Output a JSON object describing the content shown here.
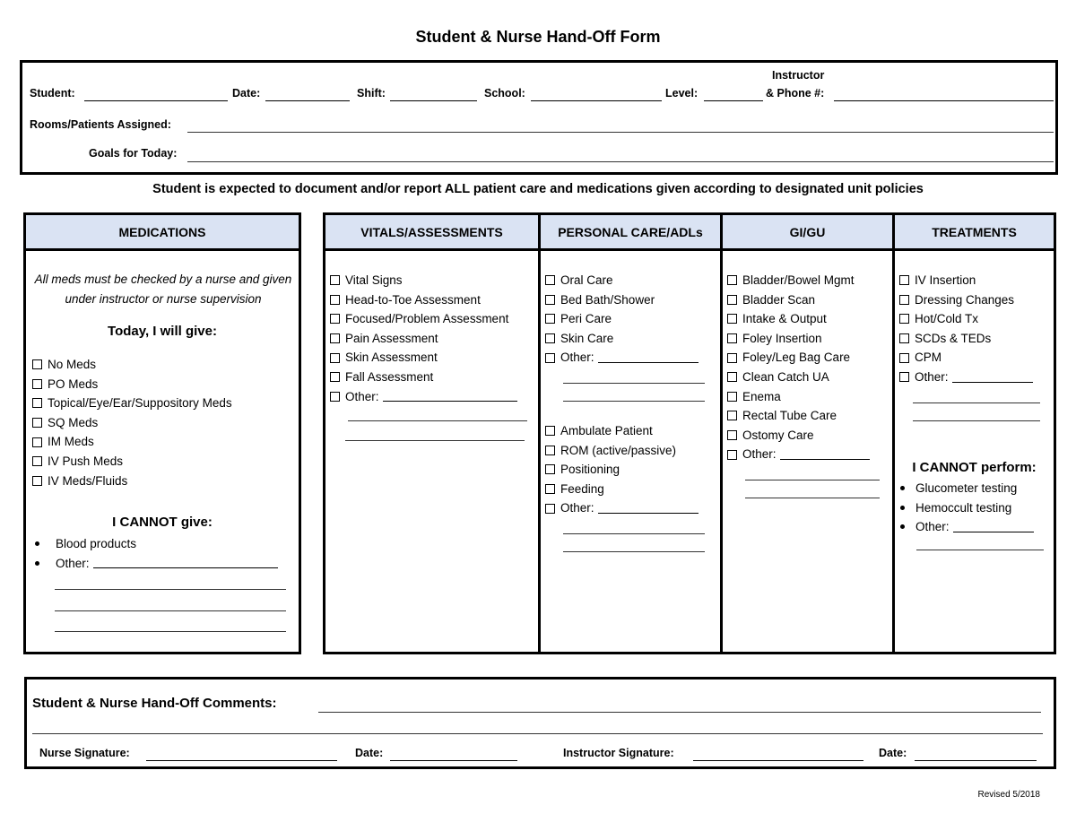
{
  "title": "Student & Nurse Hand-Off Form",
  "header": {
    "student_label": "Student:",
    "date_label": "Date:",
    "shift_label": "Shift:",
    "school_label": "School:",
    "level_label": "Level:",
    "instructor_label_line1": "Instructor",
    "instructor_label_line2": "& Phone #:",
    "rooms_label": "Rooms/Patients Assigned:",
    "goals_label": "Goals for Today:"
  },
  "notice": "Student is expected to document and/or report ALL patient care and medications given according to designated unit policies",
  "medications": {
    "heading": "MEDICATIONS",
    "note": "All meds must be checked by a nurse and given under instructor or nurse supervision",
    "give_heading": "Today, I will give:",
    "items": [
      "No Meds",
      "PO Meds",
      "Topical/Eye/Ear/Suppository Meds",
      "SQ Meds",
      "IM Meds",
      "IV Push Meds",
      "IV Meds/Fluids"
    ],
    "cannot_heading": "I CANNOT give:",
    "cannot_items": [
      "Blood products",
      "Other:"
    ]
  },
  "vitals": {
    "heading": "VITALS/ASSESSMENTS",
    "items": [
      "Vital Signs",
      "Head-to-Toe Assessment",
      "Focused/Problem Assessment",
      "Pain Assessment",
      "Skin Assessment",
      "Fall Assessment",
      "Other:"
    ]
  },
  "personal_care": {
    "heading": "PERSONAL CARE/ADLs",
    "items_a": [
      "Oral Care",
      "Bed Bath/Shower",
      "Peri Care",
      "Skin Care",
      "Other:"
    ],
    "items_b": [
      "Ambulate Patient",
      "ROM (active/passive)",
      "Positioning",
      "Feeding",
      "Other:"
    ]
  },
  "gigu": {
    "heading": "GI/GU",
    "items": [
      "Bladder/Bowel Mgmt",
      "Bladder Scan",
      "Intake & Output",
      "Foley Insertion",
      "Foley/Leg Bag Care",
      "Clean Catch UA",
      "Enema",
      "Rectal Tube Care",
      "Ostomy Care",
      "Other:"
    ]
  },
  "treatments": {
    "heading": "TREATMENTS",
    "items": [
      "IV Insertion",
      "Dressing Changes",
      "Hot/Cold Tx",
      "SCDs & TEDs",
      "CPM",
      "Other:"
    ],
    "cannot_heading": "I CANNOT perform:",
    "cannot_items": [
      "Glucometer testing",
      "Hemoccult testing",
      "Other:"
    ]
  },
  "footer": {
    "comments_label": "Student & Nurse Hand-Off Comments:",
    "nurse_signature_label": "Nurse Signature:",
    "date1_label": "Date:",
    "instructor_signature_label": "Instructor Signature:",
    "date2_label": "Date:"
  },
  "revised": "Revised 5/2018"
}
